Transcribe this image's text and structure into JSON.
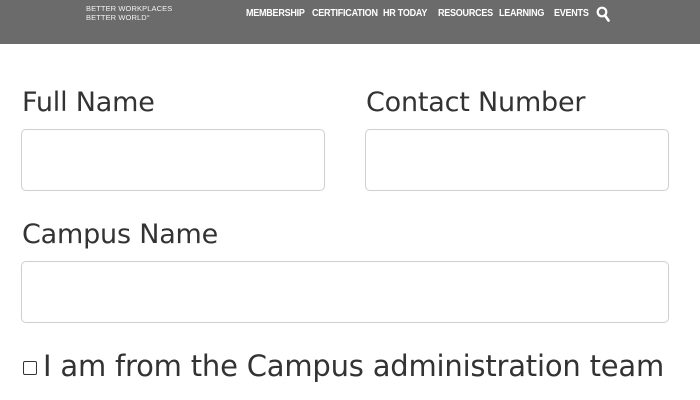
{
  "header": {
    "tagline_line1": "BETTER WORKPLACES",
    "tagline_line2": "BETTER WORLD°",
    "nav": [
      {
        "label": "MEMBERSHIP"
      },
      {
        "label": "CERTIFICATION"
      },
      {
        "label": "HR TODAY"
      },
      {
        "label": "RESOURCES"
      },
      {
        "label": "LEARNING"
      },
      {
        "label": "EVENTS"
      }
    ],
    "search_icon": "search-icon"
  },
  "form": {
    "full_name_label": "Full Name",
    "full_name_value": "",
    "contact_number_label": "Contact Number",
    "contact_number_value": "",
    "campus_name_label": "Campus Name",
    "campus_name_value": "",
    "admin_checkbox_label": "I am from the Campus administration team",
    "admin_checkbox_checked": false
  },
  "colors": {
    "topbar": "#6b6b6b",
    "text": "#333333",
    "field_border": "#cfcfcf"
  }
}
